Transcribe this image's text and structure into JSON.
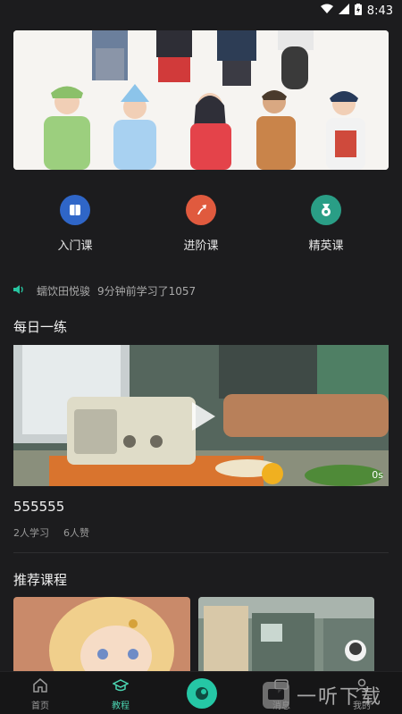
{
  "status_bar": {
    "time": "8:43"
  },
  "quick_actions": [
    {
      "label": "入门课",
      "icon": "book-icon",
      "color": "#2f66c8"
    },
    {
      "label": "进阶课",
      "icon": "arrow-up-icon",
      "color": "#e05a3e"
    },
    {
      "label": "精英课",
      "icon": "medal-icon",
      "color": "#2a9e86"
    }
  ],
  "notice": {
    "user": "蠕饮田悦骏",
    "message": "9分钟前学习了1057"
  },
  "daily": {
    "title": "每日一练",
    "video_duration": "0s",
    "lesson_title": "555555",
    "learners": "2人学习",
    "likes": "6人赞"
  },
  "recommend": {
    "title": "推荐课程"
  },
  "tabs": [
    {
      "label": "首页",
      "icon": "home-icon"
    },
    {
      "label": "教程",
      "icon": "graduation-cap-icon"
    },
    {
      "label": "",
      "icon": "center-app-icon"
    },
    {
      "label": "消息",
      "icon": "message-icon"
    },
    {
      "label": "我的",
      "icon": "user-icon"
    }
  ],
  "watermark": {
    "text": "一听下载"
  },
  "colors": {
    "accent": "#25c7a5",
    "background": "#1c1c1e"
  }
}
